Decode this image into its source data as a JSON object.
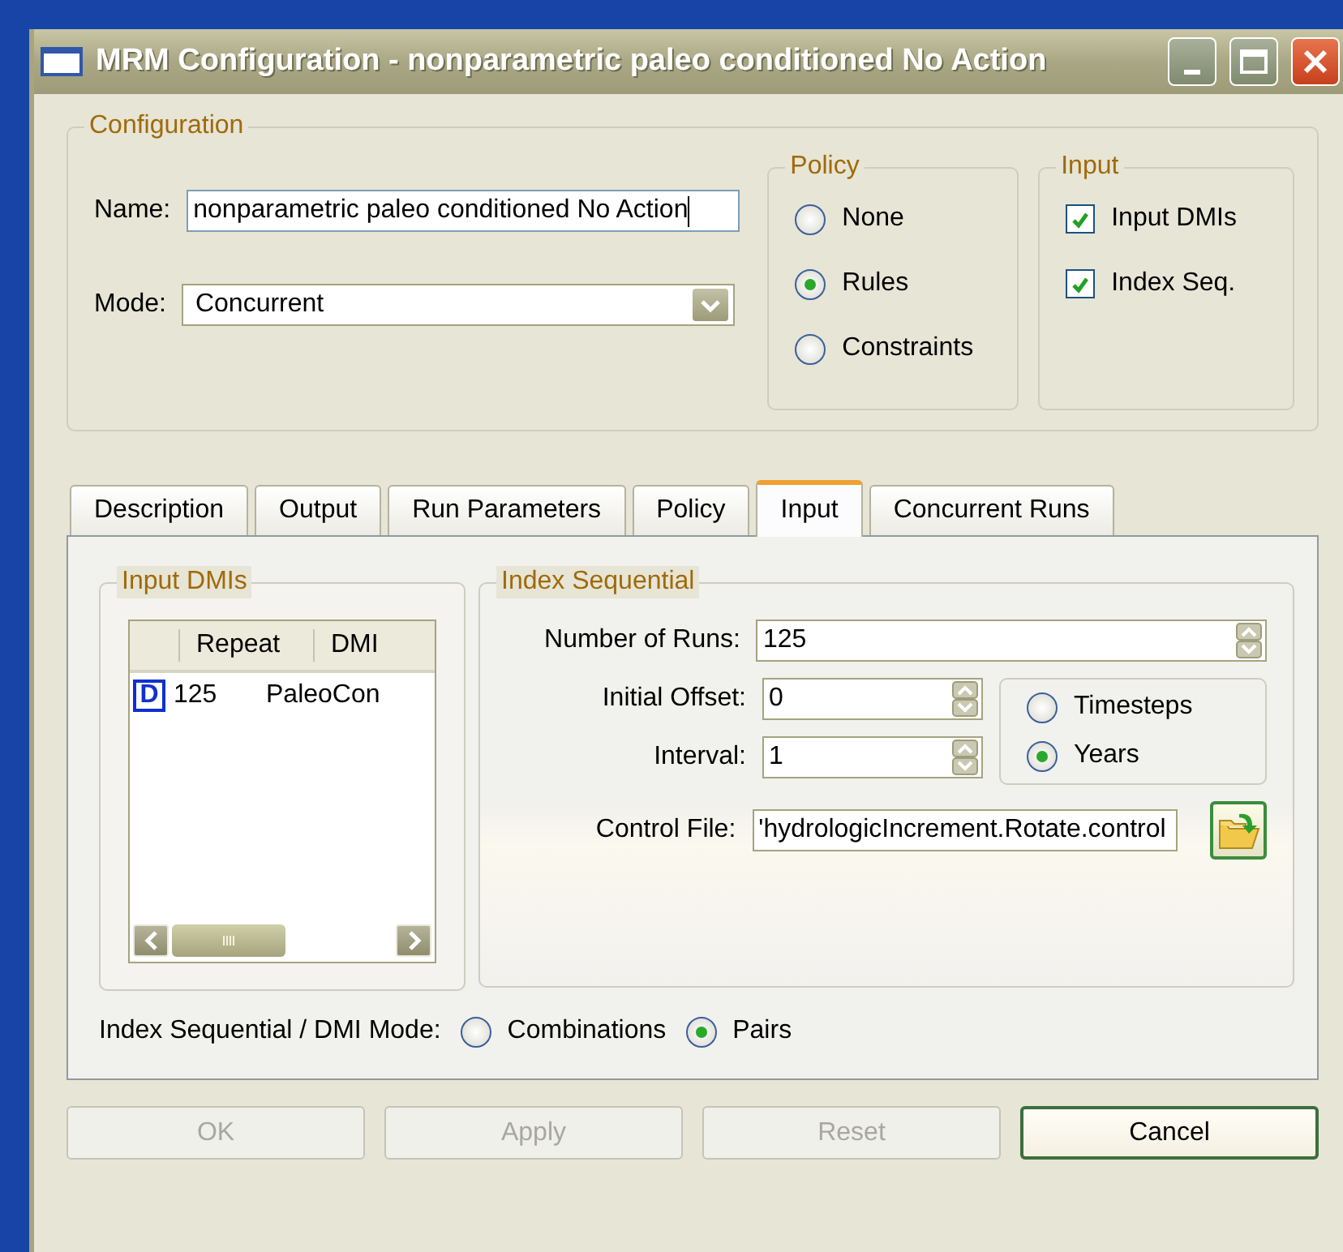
{
  "window": {
    "title": "MRM Configuration - nonparametric paleo conditioned No Action"
  },
  "configuration": {
    "title": "Configuration",
    "name_label": "Name:",
    "name_value": "nonparametric paleo conditioned No Action",
    "mode_label": "Mode:",
    "mode_value": "Concurrent",
    "policy": {
      "title": "Policy",
      "options": [
        {
          "label": "None",
          "selected": false
        },
        {
          "label": "Rules",
          "selected": true
        },
        {
          "label": "Constraints",
          "selected": false
        }
      ]
    },
    "input": {
      "title": "Input",
      "options": [
        {
          "label": "Input DMIs",
          "checked": true
        },
        {
          "label": "Index Seq.",
          "checked": true
        }
      ]
    }
  },
  "tabs": [
    {
      "label": "Description",
      "selected": false
    },
    {
      "label": "Output",
      "selected": false
    },
    {
      "label": "Run Parameters",
      "selected": false
    },
    {
      "label": "Policy",
      "selected": false
    },
    {
      "label": "Input",
      "selected": true
    },
    {
      "label": "Concurrent Runs",
      "selected": false
    }
  ],
  "input_dmis": {
    "title": "Input DMIs",
    "columns": [
      "Repeat",
      "DMI"
    ],
    "rows": [
      {
        "flag": "D",
        "repeat": "125",
        "dmi": "PaleoCon"
      }
    ]
  },
  "index_sequential": {
    "title": "Index Sequential",
    "number_of_runs": {
      "label": "Number of Runs:",
      "value": "125"
    },
    "initial_offset": {
      "label": "Initial Offset:",
      "value": "0"
    },
    "interval": {
      "label": "Interval:",
      "value": "1"
    },
    "units": [
      {
        "label": "Timesteps",
        "selected": false
      },
      {
        "label": "Years",
        "selected": true
      }
    ],
    "control_file": {
      "label": "Control File:",
      "value": "'hydrologicIncrement.Rotate.control"
    }
  },
  "dmi_mode": {
    "label": "Index Sequential / DMI Mode:",
    "options": [
      {
        "label": "Combinations",
        "selected": false
      },
      {
        "label": "Pairs",
        "selected": true
      }
    ]
  },
  "buttons": [
    {
      "label": "OK",
      "disabled": true,
      "default": false
    },
    {
      "label": "Apply",
      "disabled": true,
      "default": false
    },
    {
      "label": "Reset",
      "disabled": true,
      "default": false
    },
    {
      "label": "Cancel",
      "disabled": false,
      "default": true
    }
  ]
}
